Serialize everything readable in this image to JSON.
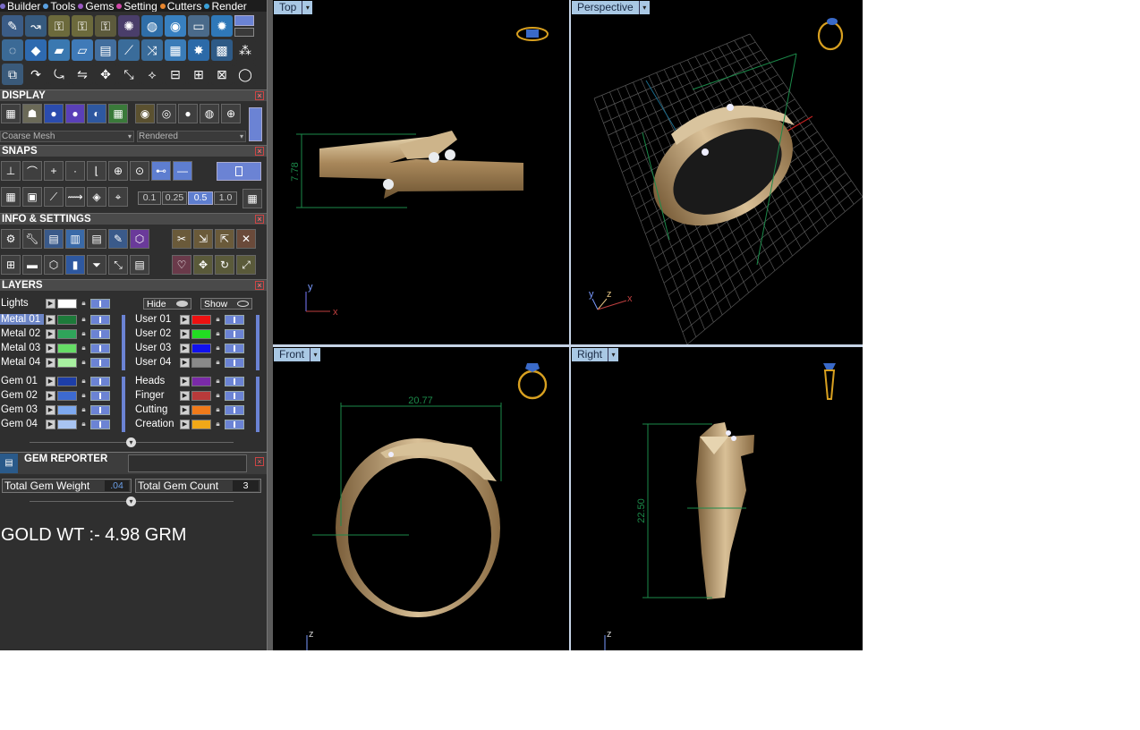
{
  "menu": [
    {
      "label": "Builder",
      "dot": "#7a6cc8"
    },
    {
      "label": "Tools",
      "dot": "#5aa0e0"
    },
    {
      "label": "Gems",
      "dot": "#9a59c4"
    },
    {
      "label": "Setting",
      "dot": "#d048a8"
    },
    {
      "label": "Cutters",
      "dot": "#e8862e"
    },
    {
      "label": "Render",
      "dot": "#3aa0d8"
    }
  ],
  "display": {
    "title": "DISPLAY",
    "mesh_select": "Coarse Mesh",
    "render_select": "Rendered"
  },
  "snaps": {
    "title": "SNAPS",
    "values": [
      "0.1",
      "0.25",
      "0.5",
      "1.0"
    ]
  },
  "info": {
    "title": "INFO & SETTINGS"
  },
  "layers": {
    "title": "LAYERS",
    "lights_label": "Lights",
    "hide_label": "Hide",
    "show_label": "Show",
    "metal": [
      {
        "name": "Metal 01",
        "color": "#1d7a3a"
      },
      {
        "name": "Metal 02",
        "color": "#2fa45a"
      },
      {
        "name": "Metal 03",
        "color": "#66dd66"
      },
      {
        "name": "Metal 04",
        "color": "#a8f0a0"
      }
    ],
    "user": [
      {
        "name": "User 01",
        "color": "#ee1111"
      },
      {
        "name": "User 02",
        "color": "#22dd22"
      },
      {
        "name": "User 03",
        "color": "#1111ee"
      },
      {
        "name": "User 04",
        "color": "#8a8a8a"
      }
    ],
    "gem": [
      {
        "name": "Gem 01",
        "color": "#1d3ea8"
      },
      {
        "name": "Gem 02",
        "color": "#3d6ad0"
      },
      {
        "name": "Gem 03",
        "color": "#7da8ee"
      },
      {
        "name": "Gem 04",
        "color": "#a8c4f2"
      }
    ],
    "other": [
      {
        "name": "Heads",
        "color": "#7a2aa8"
      },
      {
        "name": "Finger",
        "color": "#b83a3a"
      },
      {
        "name": "Cutting",
        "color": "#f07a1a"
      },
      {
        "name": "Creation",
        "color": "#f0a818"
      }
    ]
  },
  "gem_reporter": {
    "title": "GEM REPORTER",
    "weight_label": "Total Gem Weight",
    "weight_value": ".04",
    "count_label": "Total Gem Count",
    "count_value": "3"
  },
  "note": "GOLD WT :- 4.98 GRM",
  "viewports": {
    "top": {
      "label": "Top",
      "dim": "7.78",
      "axis1": "y",
      "axis2": "x"
    },
    "perspective": {
      "label": "Perspective",
      "axis1": "y",
      "axis2": "z",
      "axis3": "x"
    },
    "front": {
      "label": "Front",
      "dim": "20.77",
      "axis": "z"
    },
    "right": {
      "label": "Right",
      "dim": "22.50",
      "axis": "z"
    }
  }
}
